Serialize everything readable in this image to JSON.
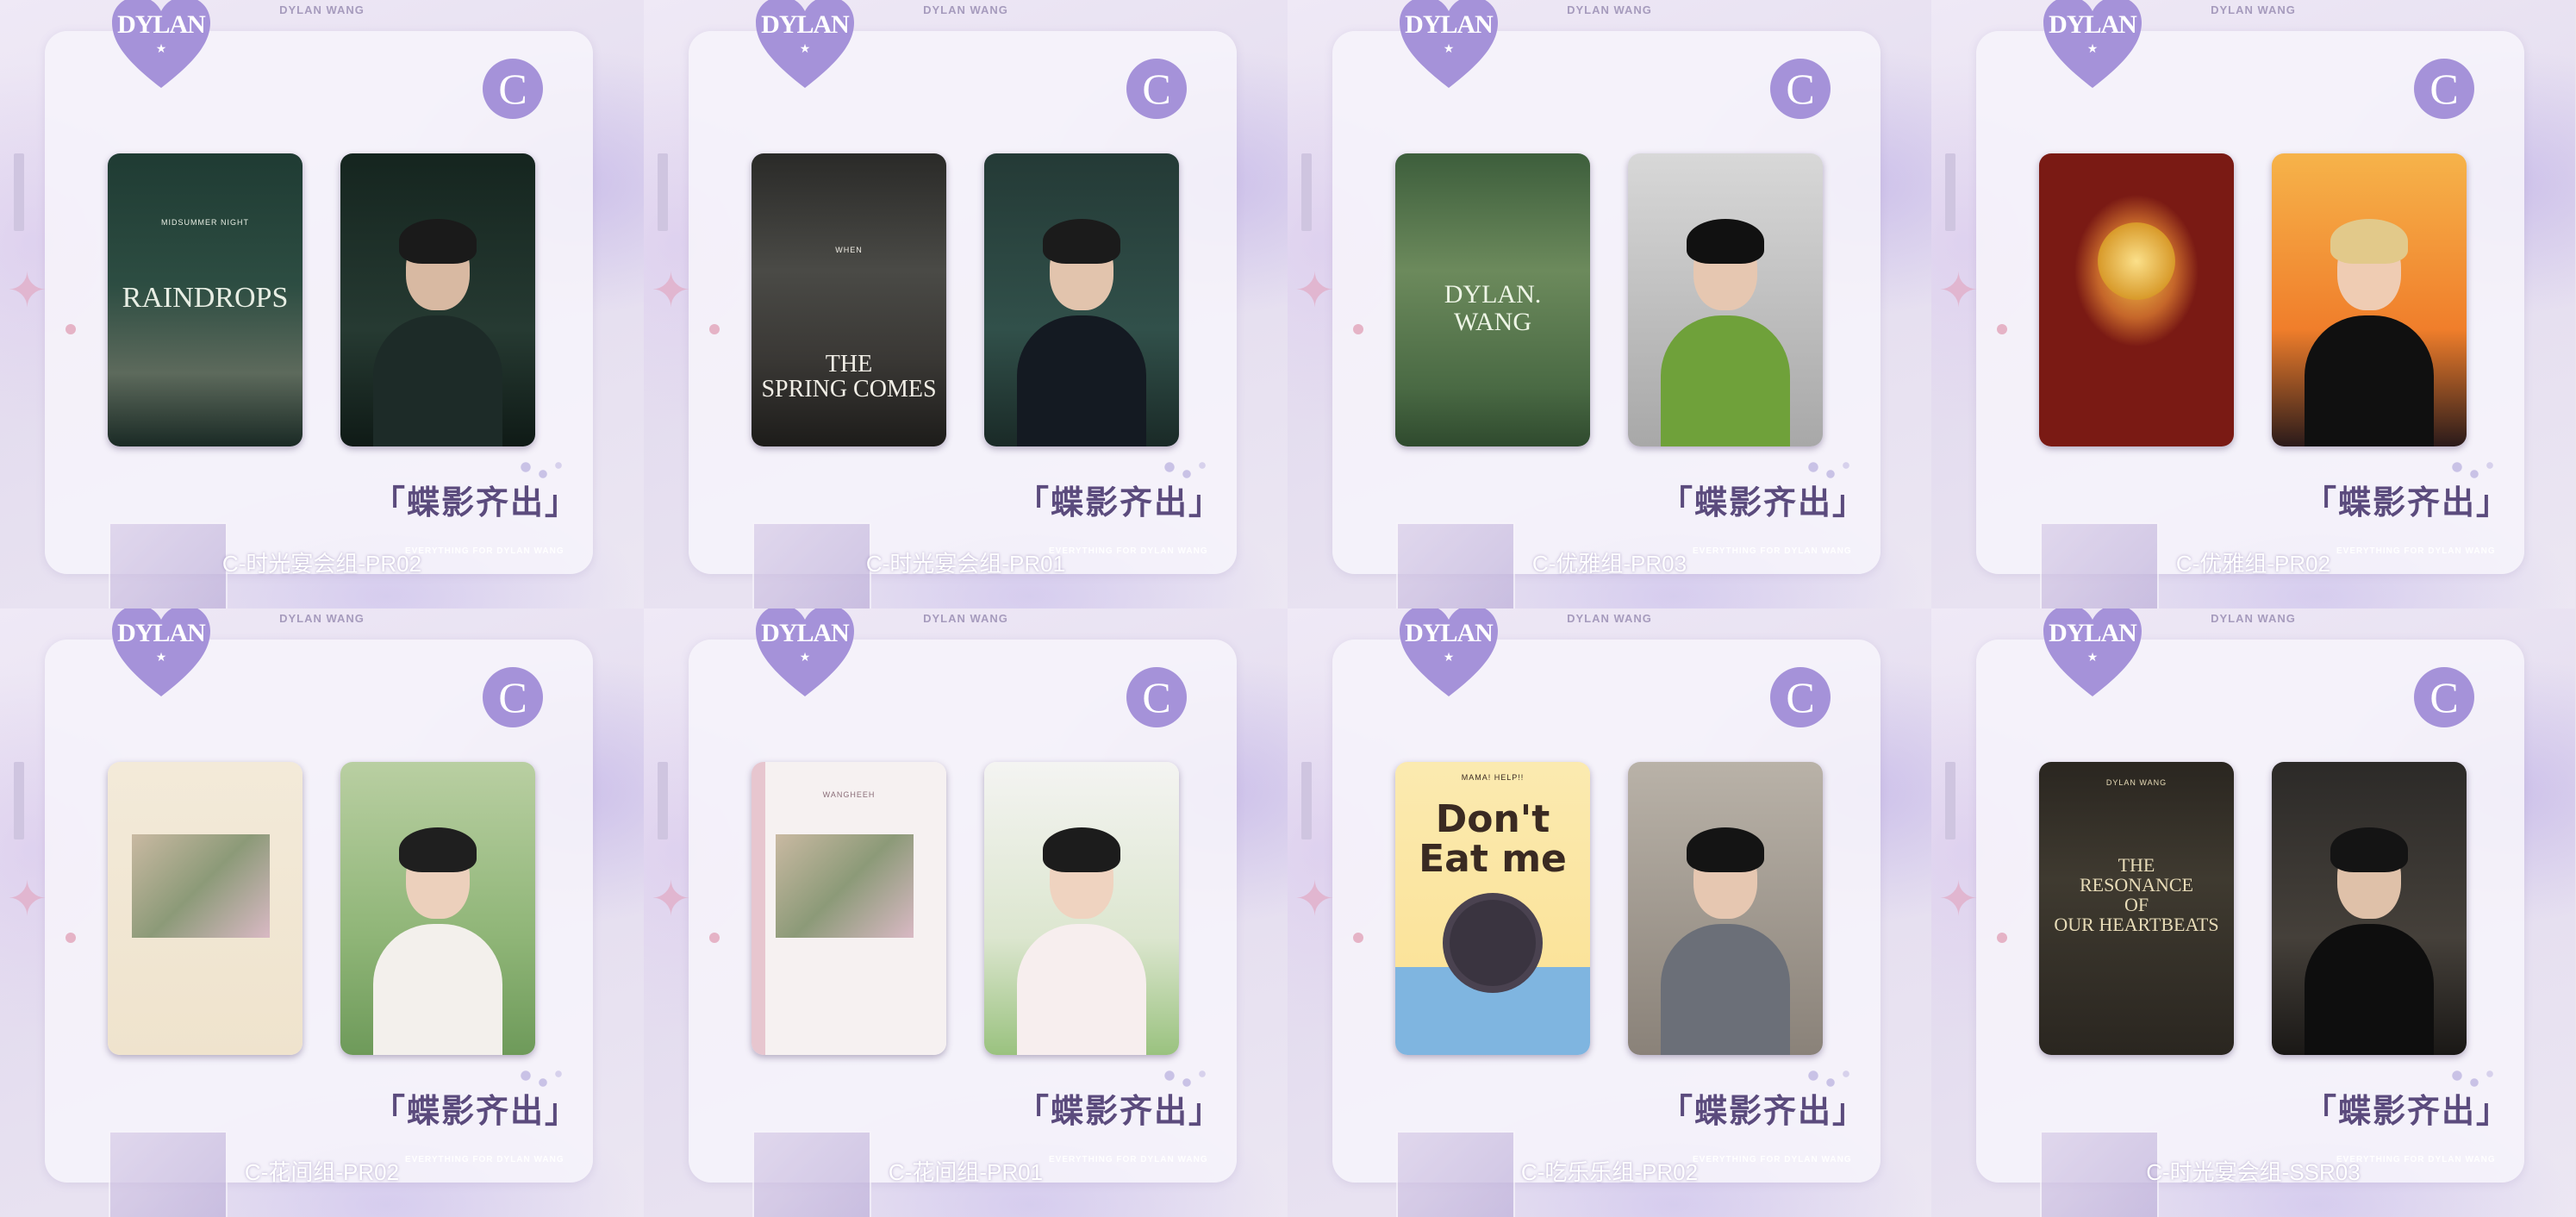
{
  "colors": {
    "accent_purple": "#a592d9",
    "calligraphy": "#5b4b7d",
    "panel_background": "#ede8f3"
  },
  "common": {
    "heart_badge_text": "DYLAN",
    "heart_badge_star": "★",
    "rank_letter": "C",
    "calligraphy_text": "「蝶影齐出」",
    "brand_text": "EVERYTHING FOR DYLAN WANG",
    "top_text": "DYLAN WANG"
  },
  "panels": [
    {
      "caption": "C-时光宴会组-PR02",
      "left_card": {
        "style": "raindrops",
        "title": "RAINDROPS",
        "subtitle": "MIDSUMMER NIGHT"
      },
      "right_card": {
        "style": "dark-green"
      }
    },
    {
      "caption": "C-时光宴会组-PR01",
      "left_card": {
        "style": "spring",
        "title": "THE\nSPRING COMES",
        "subtitle": "WHEN"
      },
      "right_card": {
        "style": "dark-teal"
      }
    },
    {
      "caption": "C-优雅组-PR03",
      "left_card": {
        "style": "green-logo",
        "title": "DYLAN.\nWANG",
        "subtitle": ""
      },
      "right_card": {
        "style": "green-suit"
      }
    },
    {
      "caption": "C-优雅组-PR02",
      "left_card": {
        "style": "red-gold",
        "title": "",
        "subtitle": ""
      },
      "right_card": {
        "style": "fire-blond"
      }
    },
    {
      "caption": "C-花间组-PR02",
      "left_card": {
        "style": "cream-flowers",
        "title": "",
        "subtitle": ""
      },
      "right_card": {
        "style": "garden-white"
      }
    },
    {
      "caption": "C-花间组-PR01",
      "left_card": {
        "style": "pink-cherry",
        "title": "",
        "subtitle": "WANGHEEH"
      },
      "right_card": {
        "style": "field-white"
      }
    },
    {
      "caption": "C-吃乐乐组-PR02",
      "left_card": {
        "style": "cartoon",
        "title": "Don't\nEat me",
        "subtitle": "MAMA! HELP!!"
      },
      "right_card": {
        "style": "grey-hoodie"
      }
    },
    {
      "caption": "C-时光宴会组-SSR03",
      "left_card": {
        "style": "resonance",
        "title": "THE\nRESONANCE\nOF\nOUR HEARTBEATS",
        "subtitle": "DYLAN WANG"
      },
      "right_card": {
        "style": "black-suit"
      }
    }
  ]
}
